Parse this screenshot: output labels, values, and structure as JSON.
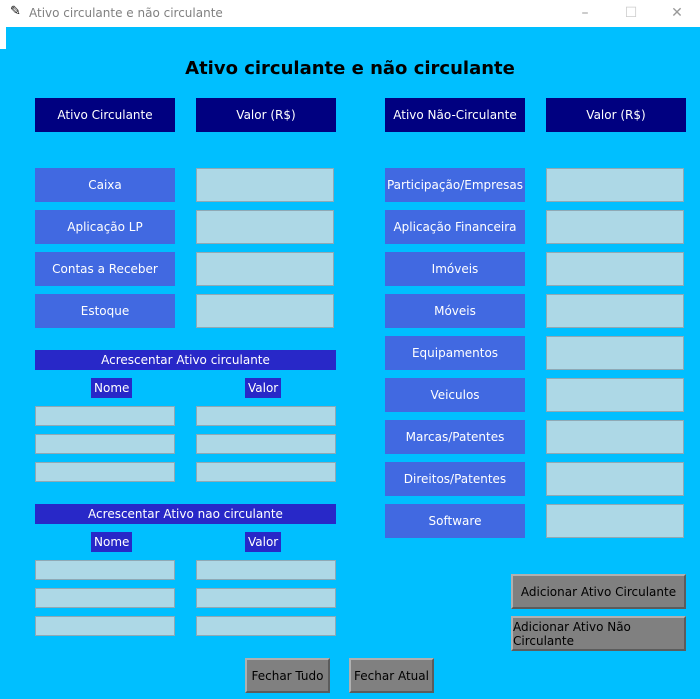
{
  "window": {
    "title": "Ativo circulante e não circulante",
    "minimize": "–",
    "maximize": "☐",
    "close": "✕"
  },
  "main_title": "Ativo circulante e não circulante",
  "left_header": {
    "col1": "Ativo Circulante",
    "col2": "Valor (R$)"
  },
  "right_header": {
    "col1": "Ativo Não-Circulante",
    "col2": "Valor (R$)"
  },
  "circulante_items": [
    "Caixa",
    "Aplicação LP",
    "Contas a Receber",
    "Estoque"
  ],
  "nao_circulante_items": [
    "Participação/Empresas",
    "Aplicação Financeira",
    "Imóveis",
    "Móveis",
    "Equipamentos",
    "Veiculos",
    "Marcas/Patentes",
    "Direitos/Patentes",
    "Software"
  ],
  "add_circulante": {
    "title": "Acrescentar Ativo circulante",
    "nome": "Nome",
    "valor": "Valor"
  },
  "add_nao_circulante": {
    "title": "Acrescentar Ativo  nao circulante",
    "nome": "Nome",
    "valor": "Valor"
  },
  "buttons": {
    "add_circulante": "Adicionar Ativo Circulante",
    "add_nao_circulante": "Adicionar Ativo  Não Circulante",
    "fechar_tudo": "Fechar Tudo",
    "fechar_atual": "Fechar Atual"
  }
}
